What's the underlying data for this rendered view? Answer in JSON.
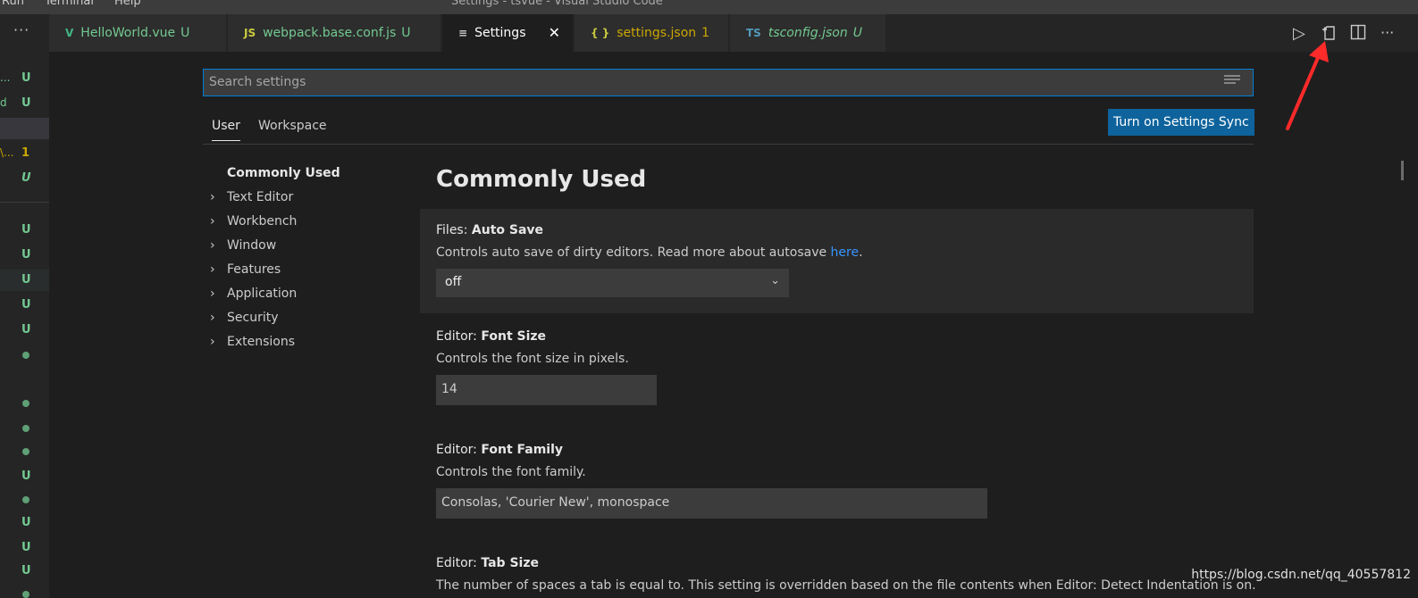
{
  "menubar": {
    "items": [
      "Run",
      "Terminal",
      "Help"
    ],
    "window_title": "Settings - tsvue - Visual Studio Code"
  },
  "sidebar": {
    "more_label": "···",
    "rows": [
      {
        "frag": "...",
        "status": "U",
        "color": "#73c991"
      },
      {
        "frag": "d",
        "status": "U",
        "color": "#73c991"
      },
      {
        "frag": "",
        "status": "",
        "color": "#73c991",
        "state": "sel"
      },
      {
        "frag": "\\...",
        "status": "1",
        "color": "#cca700"
      },
      {
        "frag": "",
        "status": "U",
        "color": "#73c991",
        "italic": true
      },
      {
        "frag": "",
        "status": "U",
        "color": "#73c991"
      },
      {
        "frag": "",
        "status": "U",
        "color": "#73c991"
      },
      {
        "frag": "",
        "status": "U",
        "color": "#73c991",
        "state": "hl"
      },
      {
        "frag": "",
        "status": "U",
        "color": "#73c991"
      },
      {
        "frag": "",
        "status": "U",
        "color": "#73c991"
      },
      {
        "frag": "",
        "status": "dot"
      },
      {
        "frag": "",
        "status": ""
      },
      {
        "frag": "",
        "status": "dot"
      },
      {
        "frag": "",
        "status": "dot"
      },
      {
        "frag": "",
        "status": "dot"
      },
      {
        "frag": "",
        "status": "U",
        "color": "#73c991"
      },
      {
        "frag": "",
        "status": "dot"
      },
      {
        "frag": "",
        "status": "U",
        "color": "#73c991"
      },
      {
        "frag": "",
        "status": "U",
        "color": "#73c991"
      },
      {
        "frag": "",
        "status": "U",
        "color": "#73c991"
      },
      {
        "frag": "",
        "status": "dot"
      }
    ]
  },
  "tabs": [
    {
      "icon": "V",
      "icon_color": "#41b883",
      "name": "HelloWorld.vue",
      "badge": "U",
      "color": "#73c991"
    },
    {
      "icon": "JS",
      "icon_color": "#cbcb41",
      "name": "webpack.base.conf.js",
      "badge": "U",
      "color": "#73c991"
    },
    {
      "icon": "≡",
      "icon_color": "#cccccc",
      "name": "Settings",
      "badge": "",
      "color": "#ffffff",
      "active": true,
      "close": "✕"
    },
    {
      "icon": "{ }",
      "icon_color": "#cbcb41",
      "name": "settings.json",
      "badge": "1",
      "color": "#cca700"
    },
    {
      "icon": "TS",
      "icon_color": "#519aba",
      "name": "tsconfig.json",
      "badge": "U",
      "color": "#73c991",
      "italic": true
    }
  ],
  "editor_actions": {
    "run": "▷",
    "open_json": "open-settings-json",
    "split": "split-editor",
    "more": "···"
  },
  "settings": {
    "search_placeholder": "Search settings",
    "scopes": [
      "User",
      "Workspace"
    ],
    "sync_button": "Turn on Settings Sync",
    "toc": [
      {
        "label": "Commonly Used",
        "current": true
      },
      {
        "label": "Text Editor"
      },
      {
        "label": "Workbench"
      },
      {
        "label": "Window"
      },
      {
        "label": "Features"
      },
      {
        "label": "Application"
      },
      {
        "label": "Security"
      },
      {
        "label": "Extensions"
      }
    ],
    "section_title": "Commonly Used",
    "items": [
      {
        "category": "Files: ",
        "key": "Auto Save",
        "desc": "Controls auto save of dirty editors. Read more about autosave ",
        "link": "here",
        "desc_end": ".",
        "value": "off",
        "kind": "select"
      },
      {
        "category": "Editor: ",
        "key": "Font Size",
        "desc": "Controls the font size in pixels.",
        "value": "14",
        "kind": "input"
      },
      {
        "category": "Editor: ",
        "key": "Font Family",
        "desc": "Controls the font family.",
        "value": "Consolas, 'Courier New', monospace",
        "kind": "input-wide"
      },
      {
        "category": "Editor: ",
        "key": "Tab Size",
        "desc": "The number of spaces a tab is equal to. This setting is overridden based on the file contents when Editor: Detect Indentation is on."
      }
    ]
  },
  "watermark": "https://blog.csdn.net/qq_40557812",
  "colors": {
    "accent": "#007fd4",
    "button": "#0e639c",
    "annotation": "#ff2a2a"
  }
}
